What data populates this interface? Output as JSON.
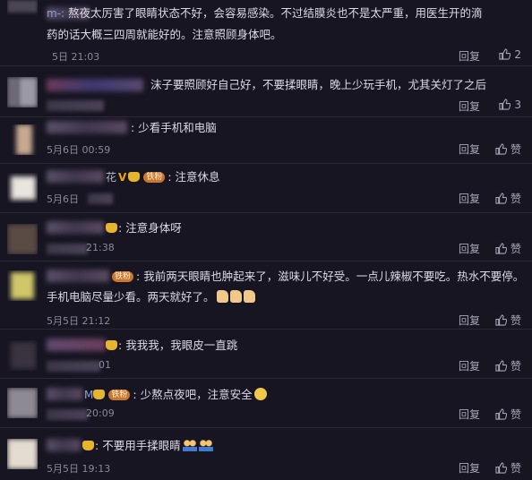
{
  "comments": [
    {
      "name": "m-:",
      "text": "熬夜太厉害了眼睛状态不好，会容易感染。不过结膜炎也不是太严重，用医生开的滴药的话大概三四周就能好的。注意照顾身体吧。",
      "text_line1": "熬夜太厉害了眼睛状态不好，会容易感染。不过结膜炎也不是太严重，用医生开的滴",
      "text_line2": "药的话大概三四周就能好的。注意照顾身体吧。",
      "time": "5日 21:03",
      "reply": "回复",
      "likes": "2"
    },
    {
      "name": "",
      "text": "沫子要照顾好自己好，不要揉眼睛，晚上少玩手机，尤其关灯了之后",
      "time": "",
      "reply": "回复",
      "likes": "3"
    },
    {
      "name": "",
      "text": "少看手机和电脑",
      "time": "5月6日 00:59",
      "reply": "回复",
      "likes": "赞"
    },
    {
      "name": "花",
      "text": "注意休息",
      "time": "5月6日",
      "reply": "回复",
      "likes": "赞"
    },
    {
      "name": "",
      "text": "注意身体呀",
      "time": "21:38",
      "reply": "回复",
      "likes": "赞"
    },
    {
      "name": "",
      "text": "我前两天眼睛也肿起来了，滋味儿不好受。一点儿辣椒不要吃。热水不要停。手机电脑尽量少看。两天就好了。",
      "text_line1": "我前两天眼睛也肿起来了，滋味儿不好受。一点儿辣椒不要吃。热水不要停。",
      "text_line2": "手机电脑尽量少看。两天就好了。",
      "time": "5月5日 21:12",
      "reply": "回复",
      "likes": "赞"
    },
    {
      "name": "",
      "text": "我我我，我眼皮一直跳",
      "time": "01",
      "reply": "回复",
      "likes": "赞"
    },
    {
      "name": "M",
      "text": "少熬点夜吧，注意安全",
      "time": "20:09",
      "reply": "回复",
      "likes": "赞"
    },
    {
      "name": "",
      "text": "不要用手揉眼睛",
      "time": "5月5日 19:13",
      "reply": "回复",
      "likes": "赞"
    }
  ],
  "badge_label": "铁粉",
  "icons": {
    "like": "thumbs-up-icon",
    "verified": "verified-v-icon",
    "fan": "crown-icon"
  },
  "colors": {
    "background": "#171522",
    "name": "#8aa3d6",
    "text": "#dcdae6",
    "meta": "#8b889a",
    "badge": "#c9762f"
  }
}
